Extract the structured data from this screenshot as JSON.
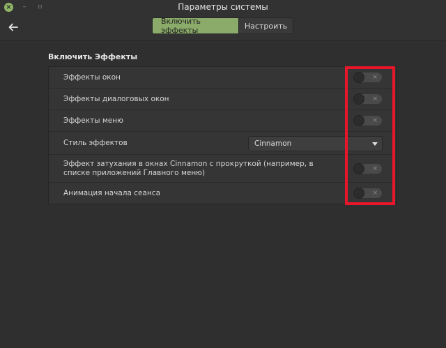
{
  "window": {
    "title": "Параметры системы",
    "close_glyph": "×",
    "minimize_glyph": "–",
    "maximize_glyph": "▫"
  },
  "header": {
    "back_icon": "back-arrow-icon",
    "tabs": [
      {
        "label": "Включить эффекты",
        "active": true
      },
      {
        "label": "Настроить",
        "active": false
      }
    ]
  },
  "section": {
    "title": "Включить Эффекты"
  },
  "settings": [
    {
      "label": "Эффекты окон",
      "type": "switch",
      "on": false
    },
    {
      "label": "Эффекты диалоговых окон",
      "type": "switch",
      "on": false
    },
    {
      "label": "Эффекты меню",
      "type": "switch",
      "on": false
    },
    {
      "label": "Стиль эффектов",
      "type": "combo",
      "value": "Cinnamon"
    },
    {
      "label": "Эффект затухания в окнах Cinnamon с прокруткой (например, в списке приложений Главного меню)",
      "type": "switch",
      "on": false
    },
    {
      "label": "Анимация начала сеанса",
      "type": "switch",
      "on": false
    }
  ],
  "toggle_off_glyph": "×",
  "colors": {
    "accent": "#8bab6a",
    "highlight": "#e8162a",
    "close_button": "#8fb665"
  }
}
